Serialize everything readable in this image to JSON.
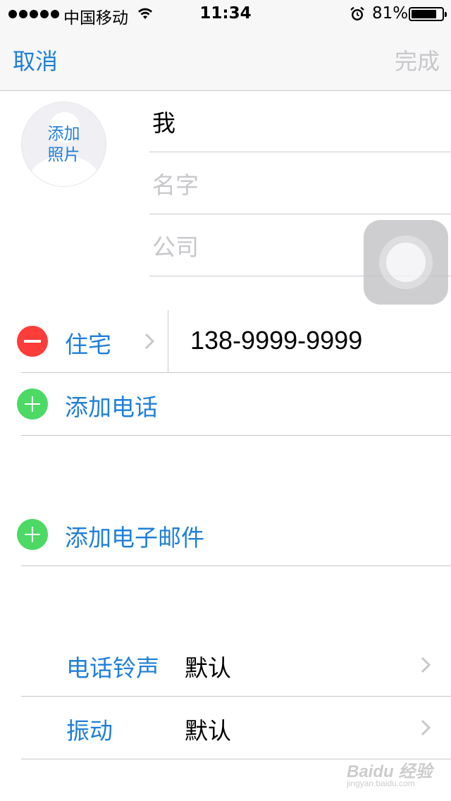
{
  "status_bar": {
    "carrier": "中国移动",
    "time": "11:34",
    "battery": "81%"
  },
  "nav": {
    "cancel": "取消",
    "done": "完成"
  },
  "contact": {
    "add_photo": "添加\n照片",
    "last_name": "我",
    "first_name_placeholder": "名字",
    "company_placeholder": "公司"
  },
  "phone": {
    "label": "住宅",
    "value": "138-9999-9999",
    "add_phone": "添加电话"
  },
  "email": {
    "add_email": "添加电子邮件"
  },
  "settings": [
    {
      "label": "电话铃声",
      "value": "默认"
    },
    {
      "label": "振动",
      "value": "默认"
    }
  ],
  "watermark": {
    "main": "Baidu 经验",
    "sub": "jingyan.baidu.com"
  },
  "icons": [
    "wifi-icon",
    "alarm-icon",
    "battery-icon",
    "minus-icon",
    "plus-icon",
    "chevron-right-icon",
    "assistive-touch-icon",
    "person-silhouette-icon"
  ],
  "colors": {
    "accent": "#1f7fd8",
    "delete": "#fc3d39",
    "add": "#4cd964",
    "disabled": "#c7c7cc"
  }
}
